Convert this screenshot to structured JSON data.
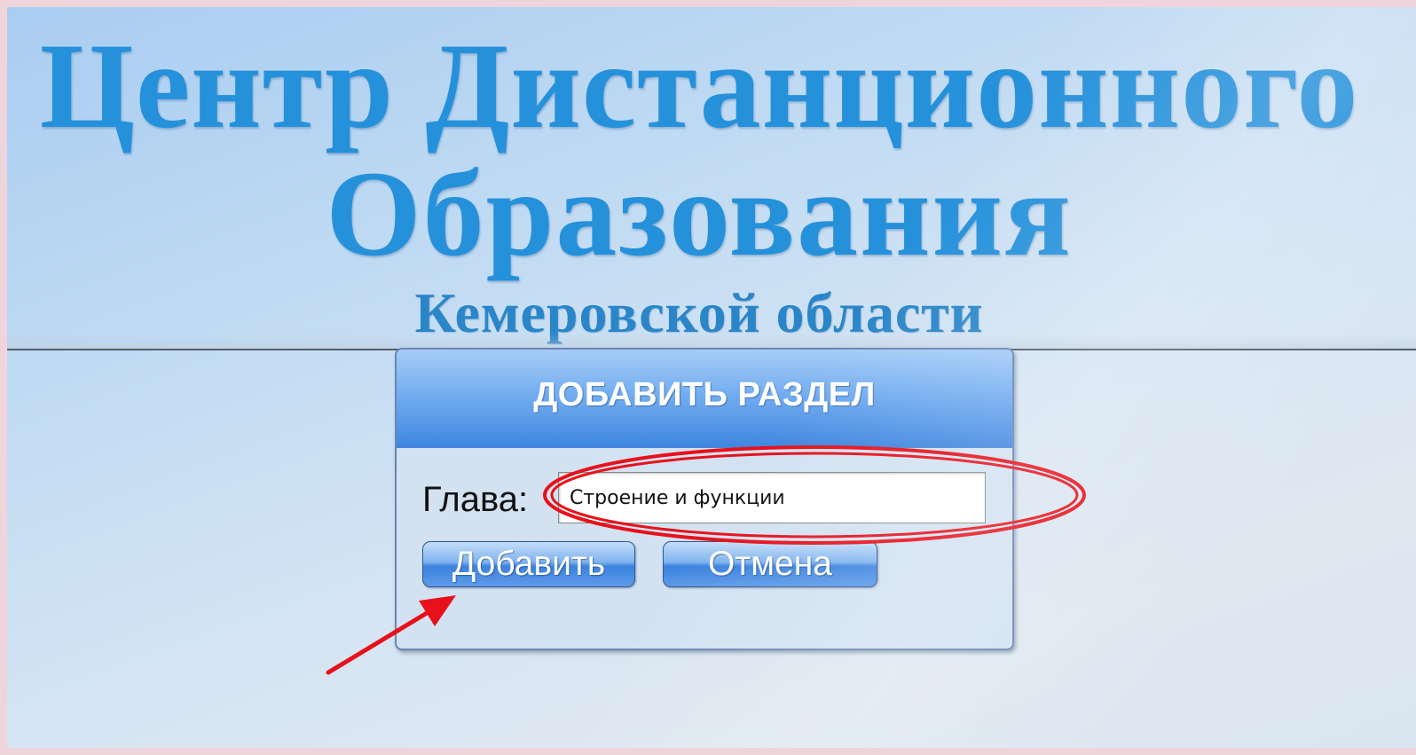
{
  "header": {
    "title_line1": "Центр Дистанционного",
    "title_line2": "Образования",
    "title_line3": "Кемеровской области"
  },
  "dialog": {
    "title": "ДОБАВИТЬ РАЗДЕЛ",
    "field_label": "Глава:",
    "field_value": "Строение и функции",
    "add_label": "Добавить",
    "cancel_label": "Отмена"
  },
  "annotations": {
    "ellipse_color": "#e8101a",
    "arrow_color": "#e8101a"
  },
  "colors": {
    "title": "#2591db",
    "dialog_header": "#4a8de2",
    "background": "#c3dcf3"
  }
}
